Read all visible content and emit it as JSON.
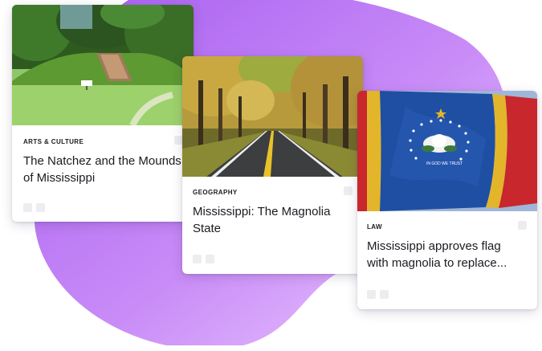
{
  "colors": {
    "blob": "#c88af5",
    "card_bg": "#ffffff",
    "text": "#1b1b22",
    "placeholder": "#ededf0"
  },
  "cards": [
    {
      "category": "ARTS & CULTURE",
      "title_line1": "The Natchez and the Mounds",
      "title_line2": "of Mississippi",
      "image": "grassy-earthen-mound"
    },
    {
      "category": "GEOGRAPHY",
      "title_line1": "Mississippi: The Magnolia",
      "title_line2": "State",
      "image": "tree-lined-road"
    },
    {
      "category": "LAW",
      "title_line1": "Mississippi approves flag",
      "title_line2": "with magnolia to replace...",
      "image": "mississippi-magnolia-flag",
      "flag_motto": "IN GOD WE TRUST"
    }
  ]
}
